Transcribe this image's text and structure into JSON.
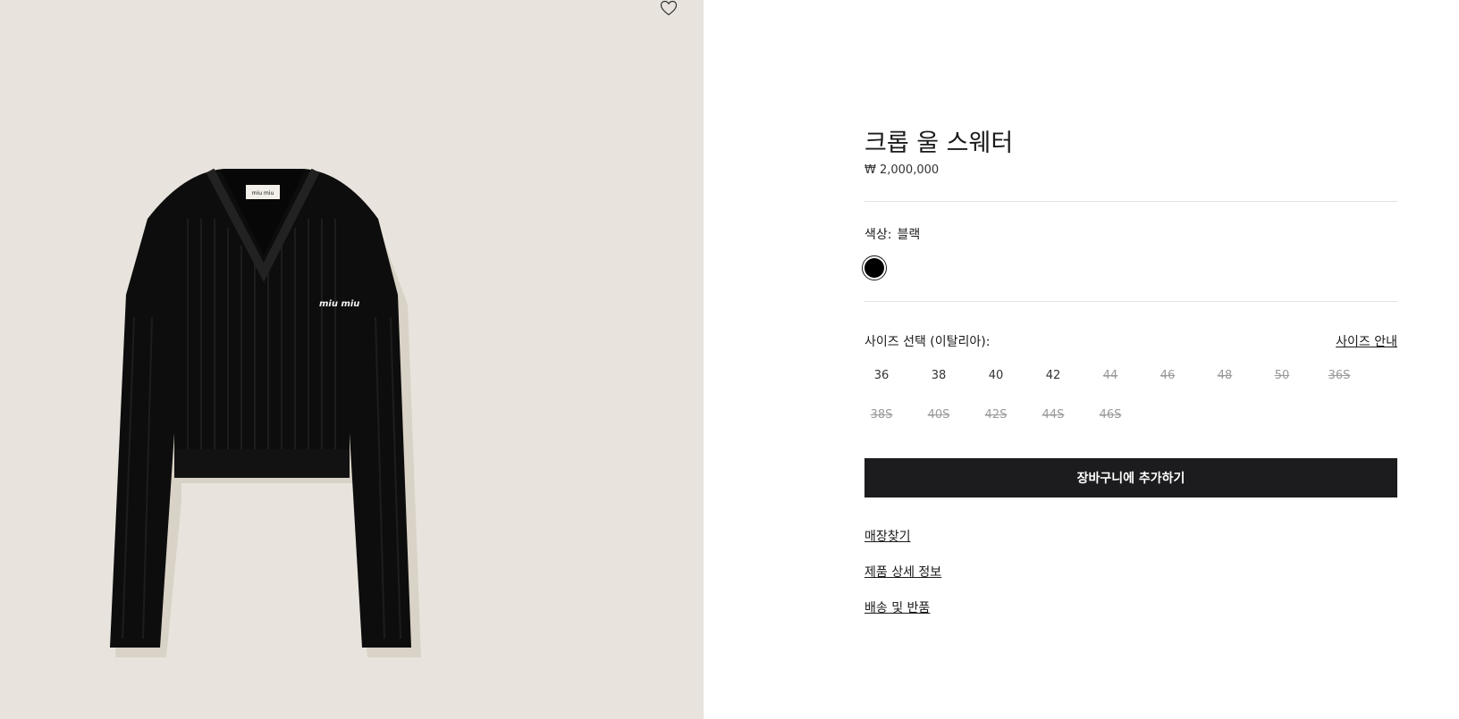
{
  "product": {
    "title": "크롭 울 스웨터",
    "price": "₩ 2,000,000",
    "image_label": "miu miu",
    "collar_label": "miu miu"
  },
  "color": {
    "label": "색상:",
    "selected": "블랙",
    "swatch_color": "#000000"
  },
  "size": {
    "label": "사이즈 선택 (이탈리아):",
    "guide": "사이즈 안내",
    "options": [
      {
        "label": "36",
        "available": true
      },
      {
        "label": "38",
        "available": true
      },
      {
        "label": "40",
        "available": true
      },
      {
        "label": "42",
        "available": true
      },
      {
        "label": "44",
        "available": false
      },
      {
        "label": "46",
        "available": false
      },
      {
        "label": "48",
        "available": false
      },
      {
        "label": "50",
        "available": false
      },
      {
        "label": "36S",
        "available": false
      },
      {
        "label": "38S",
        "available": false
      },
      {
        "label": "40S",
        "available": false
      },
      {
        "label": "42S",
        "available": false
      },
      {
        "label": "44S",
        "available": false
      },
      {
        "label": "46S",
        "available": false
      }
    ]
  },
  "actions": {
    "add_to_cart": "장바구니에 추가하기",
    "find_store": "매장찾기",
    "product_details": "제품 상세 정보",
    "shipping_returns": "배송 및 반품"
  },
  "icons": {
    "wishlist": "heart-icon"
  },
  "colors": {
    "gallery_bg": "#e8e4dd",
    "button_bg": "#1c1c1e"
  }
}
